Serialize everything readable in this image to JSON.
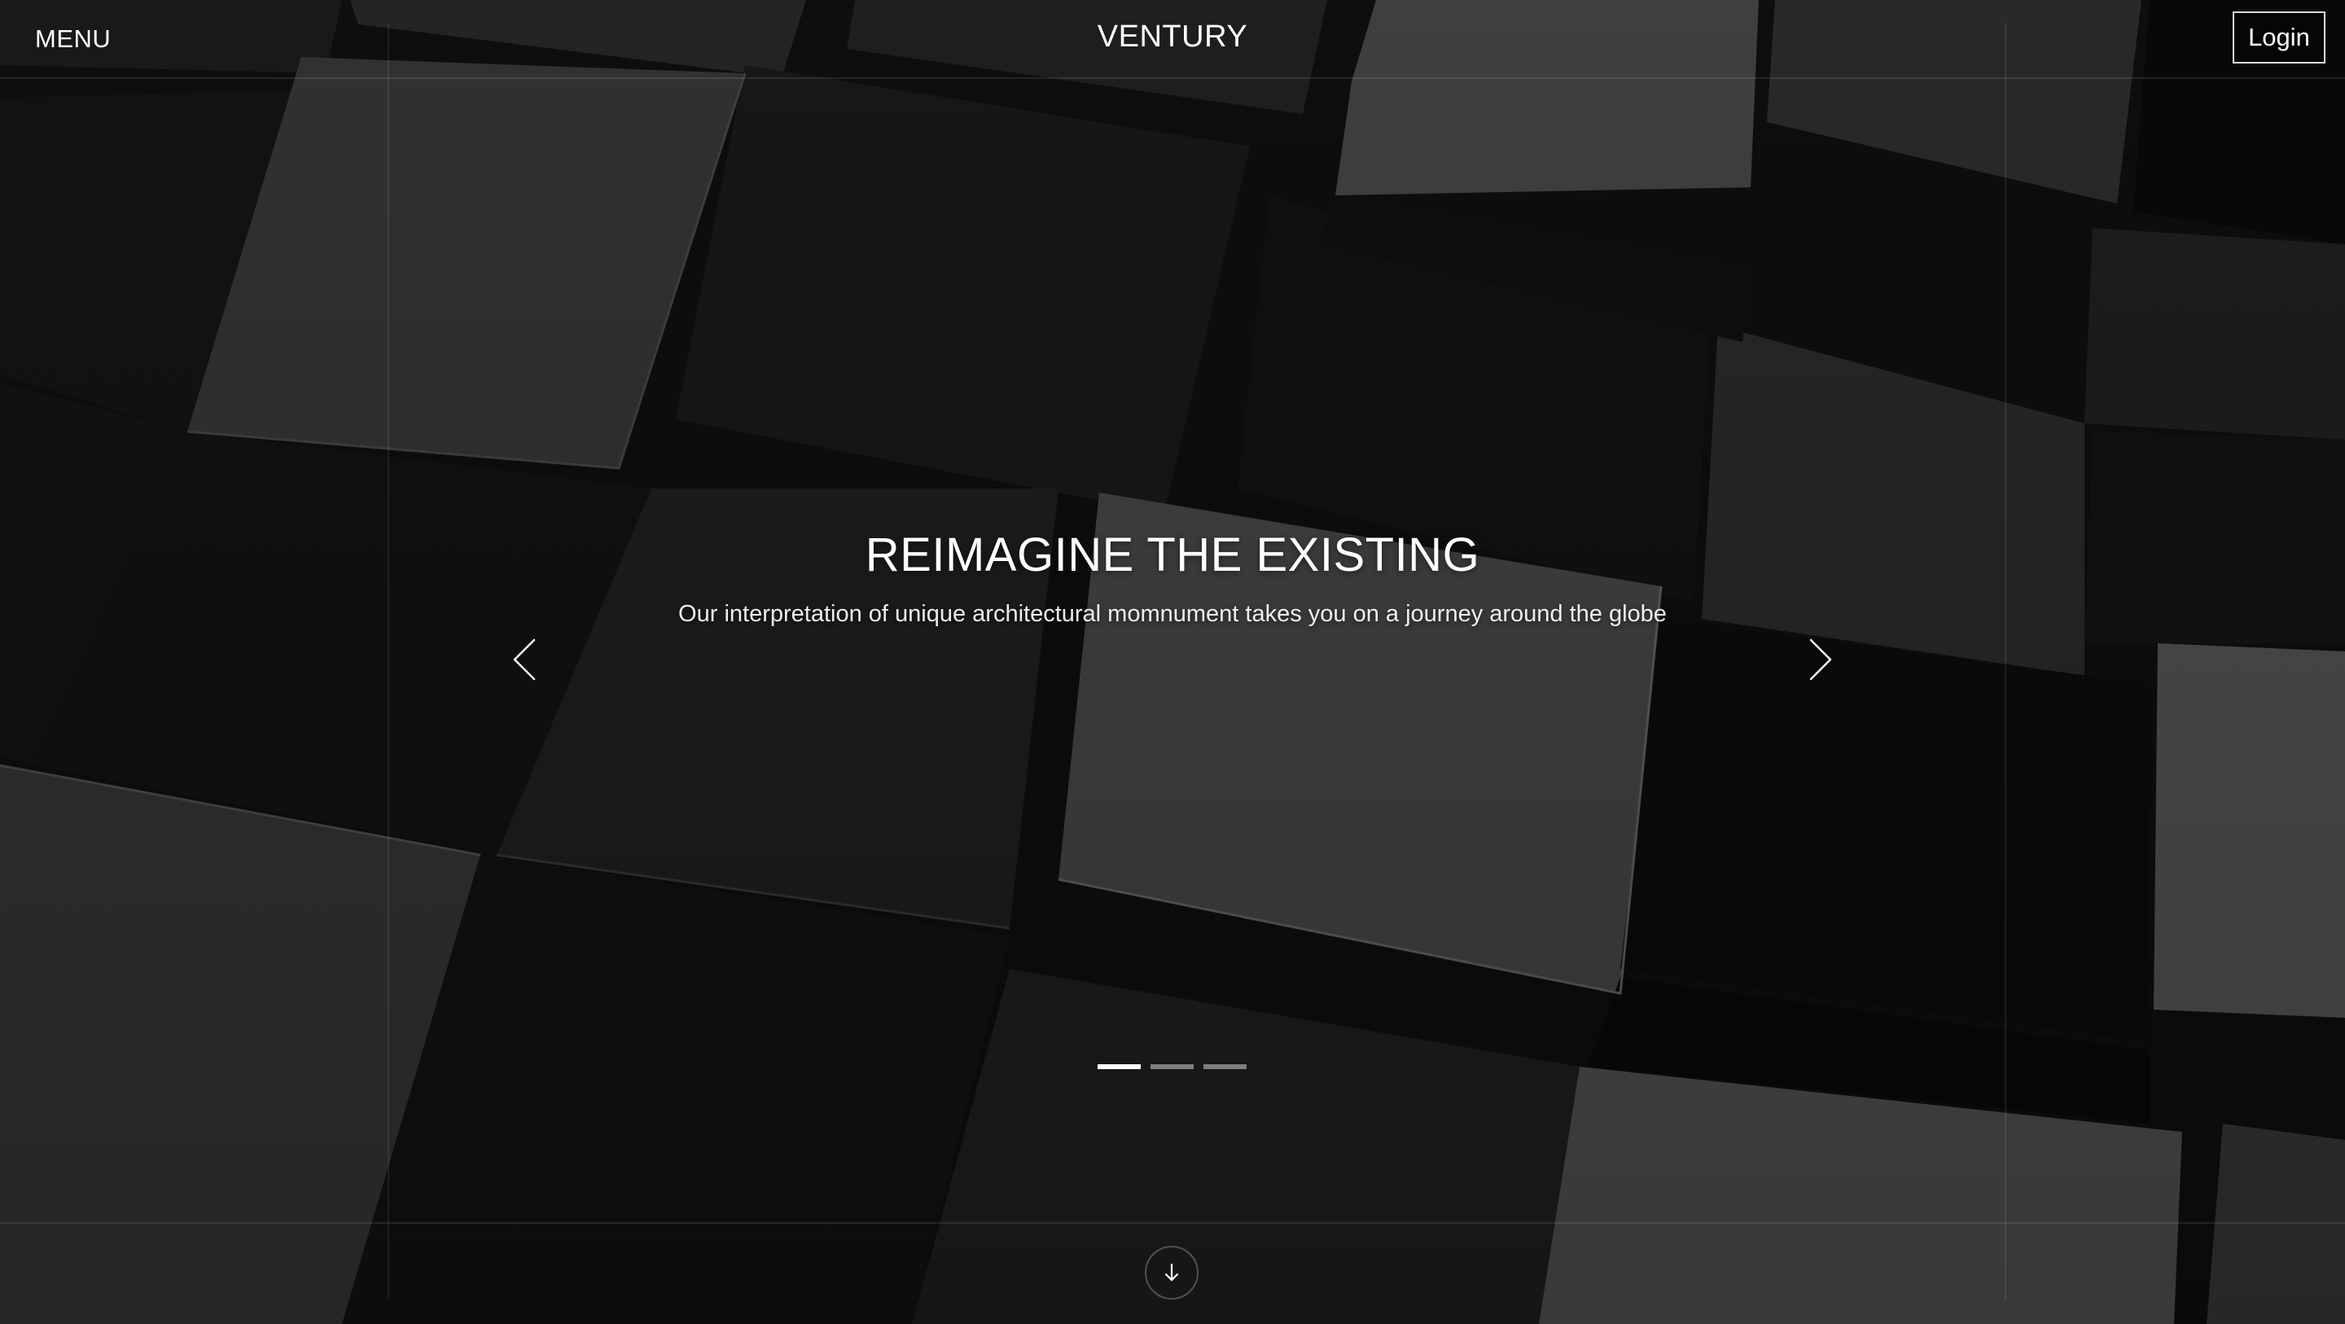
{
  "header": {
    "menu_label": "MENU",
    "brand": "VENTURY",
    "login_label": "Login"
  },
  "hero": {
    "headline": "REIMAGINE THE EXISTING",
    "subline": "Our interpretation of unique architectural momnument takes you on a journey around the globe",
    "prev_icon": "chevron-left-icon",
    "next_icon": "chevron-right-icon",
    "scroll_icon": "arrow-down-icon",
    "slides": [
      {
        "active": true
      },
      {
        "active": false
      },
      {
        "active": false
      }
    ]
  },
  "colors": {
    "background": "#0c0c0c",
    "text": "#ffffff",
    "indicator_inactive": "#8a8a8a",
    "indicator_active": "#ffffff"
  }
}
